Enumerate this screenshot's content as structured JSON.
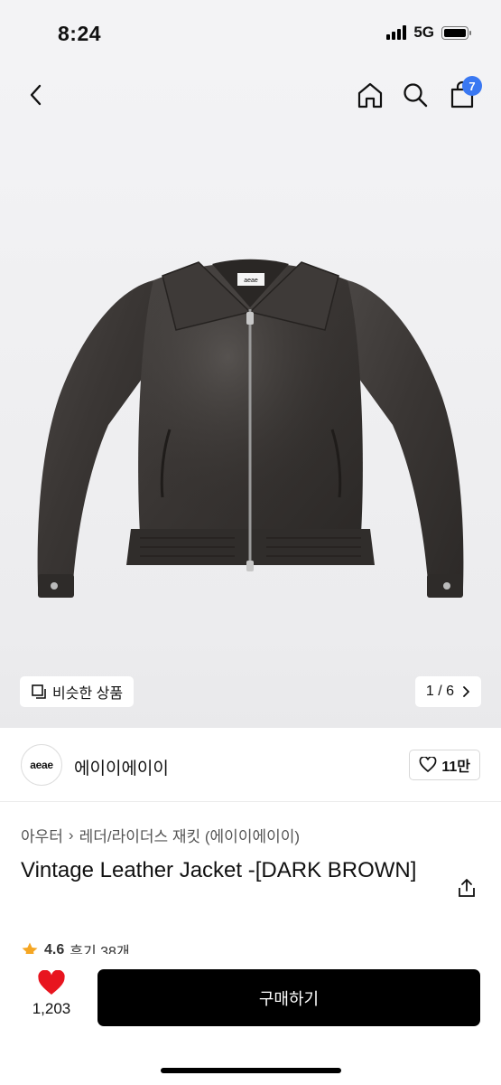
{
  "status": {
    "time": "8:24",
    "network": "5G"
  },
  "nav": {
    "cart_count": "7"
  },
  "hero": {
    "label_tag": "aeae",
    "similar_label": "비슷한 상품",
    "pager_text": "1 / 6"
  },
  "brand": {
    "logo_text": "aeae",
    "name": "에이이에이이",
    "likes": "11만"
  },
  "breadcrumb": [
    "아우터",
    "레더/라이더스 재킷 (에이이에이이)"
  ],
  "product": {
    "title": "Vintage Leather Jacket -[DARK BROWN]",
    "rating": "4.6",
    "reviews": "후기 38개"
  },
  "bottom": {
    "wish_count": "1,203",
    "buy_label": "구매하기"
  },
  "colors": {
    "accent": "#3a78f2",
    "heart": "#e8151f",
    "star": "#f5a623",
    "button": "#000000"
  },
  "icons": [
    "back-icon",
    "home-icon",
    "search-icon",
    "cart-icon",
    "copy-icon",
    "chevron-right-icon",
    "heart-outline-icon",
    "share-icon",
    "star-icon",
    "heart-filled-icon"
  ]
}
